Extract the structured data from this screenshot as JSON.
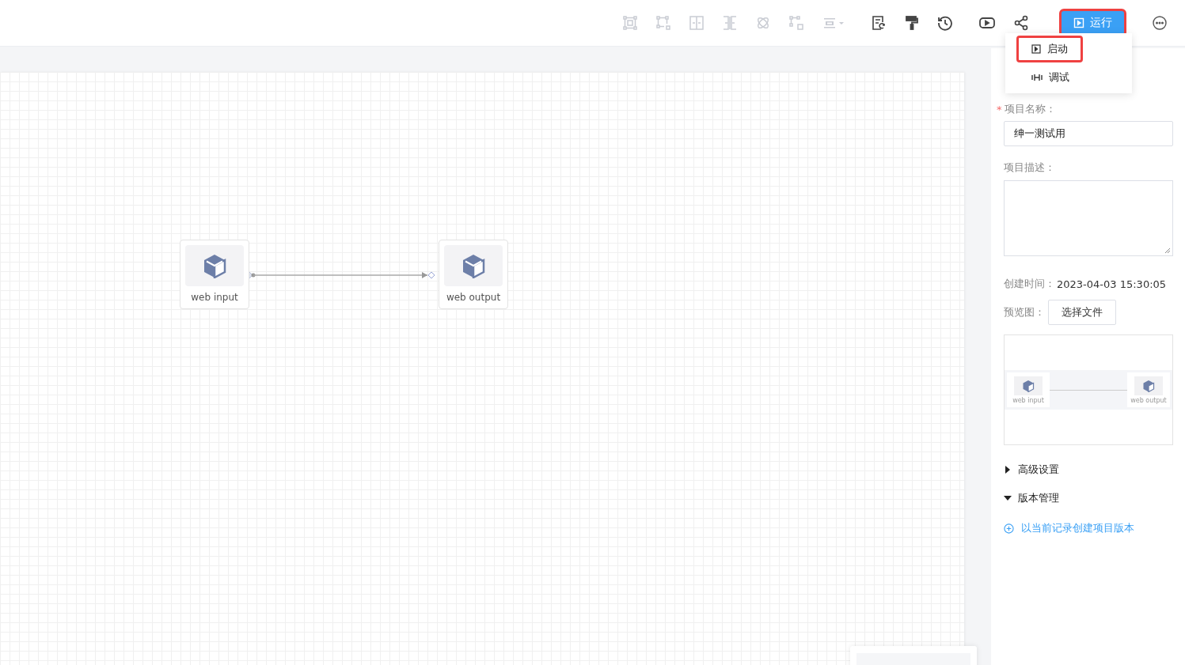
{
  "toolbar": {
    "tools": [
      {
        "disabled": true
      },
      {
        "disabled": true
      },
      {
        "disabled": true
      },
      {
        "disabled": true
      },
      {
        "disabled": true
      },
      {
        "disabled": true
      },
      {
        "disabled": true
      },
      {
        "disabled": false
      },
      {
        "disabled": false
      },
      {
        "disabled": false
      },
      {
        "disabled": false
      },
      {
        "disabled": false
      }
    ],
    "run_button": {
      "label": "运行",
      "highlighted": true
    },
    "run_menu": {
      "items": [
        {
          "label": "启动",
          "kind": "start",
          "highlighted": true
        },
        {
          "label": "调试",
          "kind": "debug",
          "highlighted": false
        }
      ]
    }
  },
  "canvas": {
    "nodes": [
      {
        "label": "web input"
      },
      {
        "label": "web output"
      }
    ]
  },
  "panel": {
    "name_field": {
      "label": "项目名称：",
      "required": true,
      "required_mark": "*",
      "value": "绅一测试用"
    },
    "description_field": {
      "label": "项目描述："
    },
    "created": {
      "label": "创建时间：",
      "value": "2023-04-03 15:30:05"
    },
    "preview": {
      "label": "预览图：",
      "button": "选择文件",
      "thumbnail_nodes": [
        "web input",
        "web output"
      ]
    },
    "sections": [
      {
        "label": "高级设置",
        "expanded": false
      },
      {
        "label": "版本管理",
        "expanded": true
      }
    ],
    "create_version_link": "以当前记录创建项目版本"
  }
}
